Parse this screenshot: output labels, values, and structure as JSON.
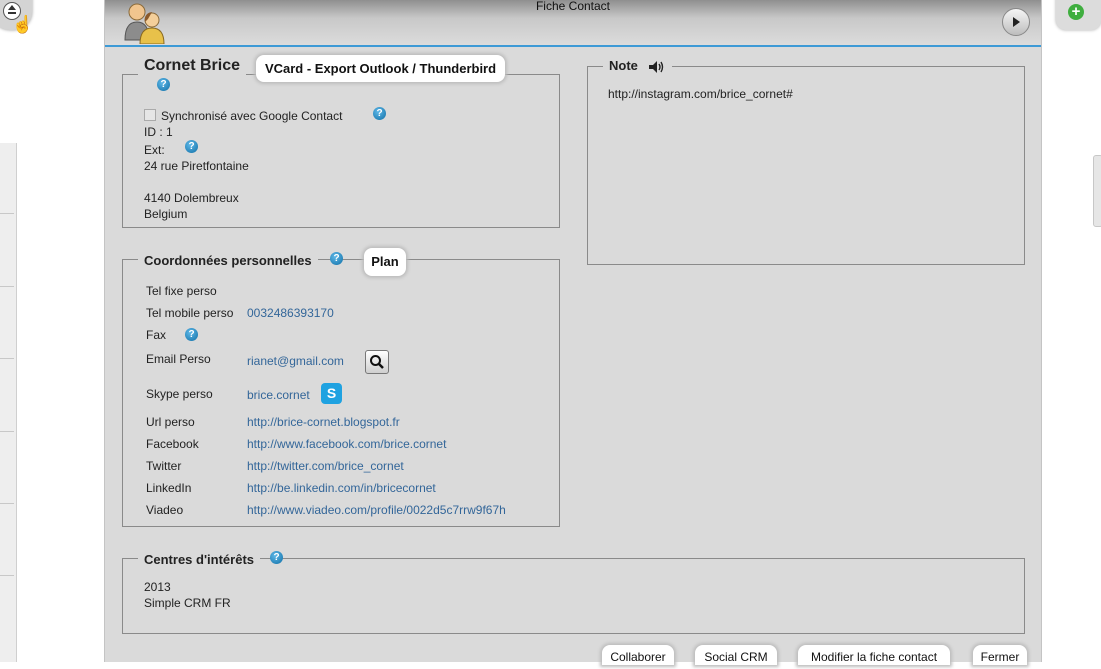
{
  "window": {
    "title": "Fiche Contact"
  },
  "contact": {
    "name": "Cornet Brice",
    "vcard_button": "VCard - Export Outlook / Thunderbird",
    "sync_label": "Synchronisé avec Google Contact",
    "id_line": "ID : 1",
    "ext_label": "Ext:",
    "address_street": "24 rue Piretfontaine",
    "address_city": "4140 Dolembreux",
    "address_country": "Belgium"
  },
  "note": {
    "label": "Note",
    "text": "http://instagram.com/brice_cornet#"
  },
  "coords": {
    "title": "Coordonnées personnelles",
    "plan_button": "Plan",
    "rows": [
      {
        "label": "Tel fixe perso",
        "value": ""
      },
      {
        "label": "Tel mobile perso",
        "value": "0032486393170"
      },
      {
        "label": "Fax",
        "value": ""
      },
      {
        "label": "Email Perso",
        "value": "rianet@gmail.com"
      },
      {
        "label": "Skype perso",
        "value": "brice.cornet"
      },
      {
        "label": "Url perso",
        "value": "http://brice-cornet.blogspot.fr"
      },
      {
        "label": "Facebook",
        "value": "http://www.facebook.com/brice.cornet"
      },
      {
        "label": "Twitter",
        "value": "http://twitter.com/brice_cornet"
      },
      {
        "label": "LinkedIn",
        "value": "http://be.linkedin.com/in/bricecornet"
      },
      {
        "label": "Viadeo",
        "value": "http://www.viadeo.com/profile/0022d5c7rrw9f67h"
      }
    ]
  },
  "interests": {
    "title": "Centres d'intérêts",
    "lines": [
      "2013",
      "Simple CRM FR"
    ]
  },
  "footer": {
    "collaborate": "Collaborer",
    "social": "Social CRM",
    "edit": "Modifier la fiche contact",
    "close": "Fermer"
  },
  "icons": {
    "help": "?",
    "skype": "S",
    "plus": "+"
  },
  "colors": {
    "accent": "#3d9ad6",
    "link": "#336699",
    "window_bg": "#dadada"
  }
}
